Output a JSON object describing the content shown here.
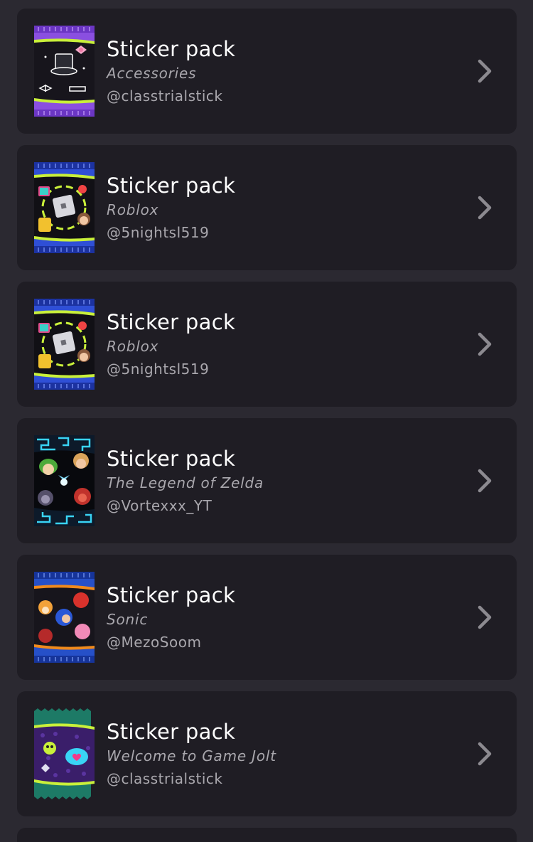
{
  "packs": [
    {
      "title": "Sticker pack",
      "subtitle": "Accessories",
      "author": "@classtrialstick",
      "icon": "accessories-pack-icon",
      "colors": {
        "wrap": "#8a4fe0",
        "dark": "#5a2fb0",
        "band": "#c9f03a"
      }
    },
    {
      "title": "Sticker pack",
      "subtitle": "Roblox",
      "author": "@5nightsl519",
      "icon": "roblox-pack-icon",
      "colors": {
        "wrap": "#2f4fd6",
        "dark": "#1c32a0",
        "band": "#c9f03a"
      }
    },
    {
      "title": "Sticker pack",
      "subtitle": "Roblox",
      "author": "@5nightsl519",
      "icon": "roblox-pack-icon",
      "colors": {
        "wrap": "#2f4fd6",
        "dark": "#1c32a0",
        "band": "#c9f03a"
      }
    },
    {
      "title": "Sticker pack",
      "subtitle": "The Legend of Zelda",
      "author": "@Vortexxx_YT",
      "icon": "zelda-pack-icon",
      "colors": {
        "wrap": "#0d1a2a",
        "dark": "#0a0f18",
        "band": "#39d4f5"
      }
    },
    {
      "title": "Sticker pack",
      "subtitle": "Sonic",
      "author": "@MezoSoom",
      "icon": "sonic-pack-icon",
      "colors": {
        "wrap": "#2650c8",
        "dark": "#16349a",
        "band": "#f08a1c"
      }
    },
    {
      "title": "Sticker pack",
      "subtitle": "Welcome to Game Jolt",
      "author": "@classtrialstick",
      "icon": "gamejolt-pack-icon",
      "colors": {
        "wrap": "#1d7a66",
        "dark": "#0f4f42",
        "band": "#c9f03a"
      }
    }
  ]
}
